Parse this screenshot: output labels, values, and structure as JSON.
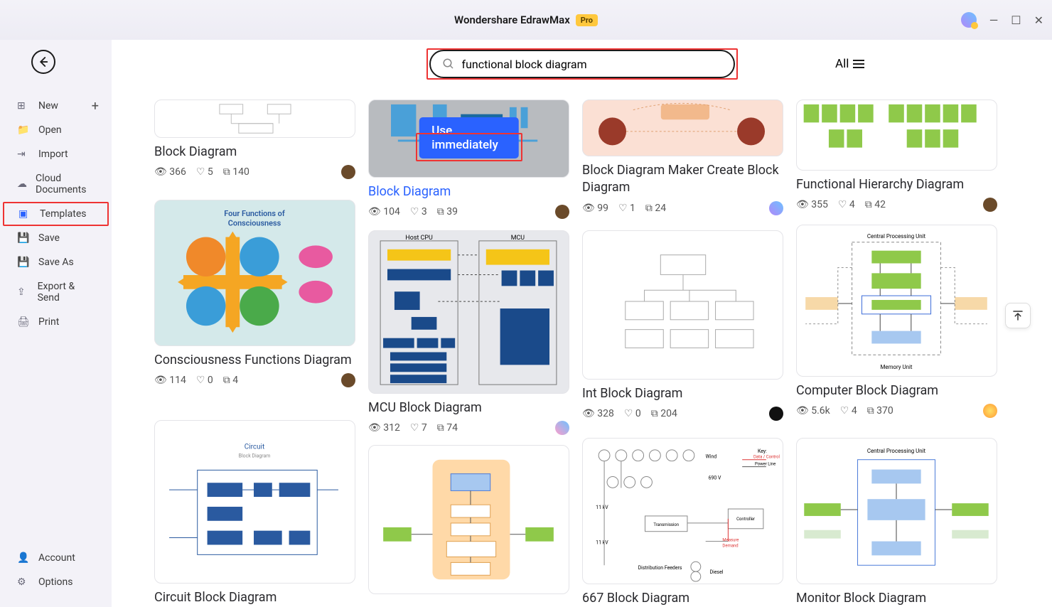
{
  "app": {
    "title": "Wondershare EdrawMax",
    "badge": "Pro"
  },
  "sidebar": {
    "items": [
      {
        "label": "New"
      },
      {
        "label": "Open"
      },
      {
        "label": "Import"
      },
      {
        "label": "Cloud Documents"
      },
      {
        "label": "Templates"
      },
      {
        "label": "Save"
      },
      {
        "label": "Save As"
      },
      {
        "label": "Export & Send"
      },
      {
        "label": "Print"
      }
    ],
    "footer": [
      {
        "label": "Account"
      },
      {
        "label": "Options"
      }
    ]
  },
  "search": {
    "value": "functional block diagram",
    "filter": "All"
  },
  "actions": {
    "use_immediately": "Use immediately"
  },
  "cards": {
    "c1": {
      "title": "Block Diagram",
      "views": "366",
      "likes": "5",
      "copies": "140"
    },
    "c2": {
      "title": "Block Diagram",
      "views": "104",
      "likes": "3",
      "copies": "39"
    },
    "c3": {
      "title": "Block Diagram Maker Create Block Diagram",
      "views": "99",
      "likes": "1",
      "copies": "24"
    },
    "c4": {
      "title": "Functional Hierarchy Diagram",
      "views": "355",
      "likes": "4",
      "copies": "42"
    },
    "c5": {
      "title": "Consciousness Functions Diagram",
      "views": "114",
      "likes": "0",
      "copies": "4"
    },
    "c6": {
      "title": "MCU Block Diagram",
      "views": "312",
      "likes": "7",
      "copies": "74"
    },
    "c7": {
      "title": "Int Block Diagram",
      "views": "328",
      "likes": "0",
      "copies": "204"
    },
    "c8": {
      "title": "Computer Block Diagram",
      "views": "5.6k",
      "likes": "4",
      "copies": "370"
    },
    "c9": {
      "title": "Circuit Block Diagram"
    },
    "c10": {
      "title": "667 Block Diagram"
    },
    "c11": {
      "title": "Monitor Block Diagram"
    }
  }
}
